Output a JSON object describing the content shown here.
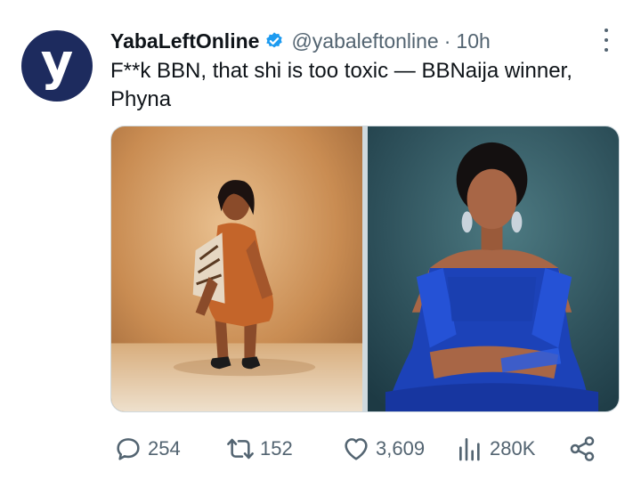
{
  "account": {
    "avatar_letter": "y",
    "name": "YabaLeftOnline",
    "handle": "@yabaleftonline",
    "separator": "·",
    "time": "10h"
  },
  "tweet": {
    "text": "F**k BBN, that shi is too toxic — BBNaija winner, Phyna"
  },
  "media": {
    "images": [
      {
        "name": "photo-orange-dress"
      },
      {
        "name": "photo-blue-gown"
      }
    ]
  },
  "actions": {
    "reply_count": "254",
    "retweet_count": "152",
    "like_count": "3,609",
    "views_count": "280K"
  },
  "colors": {
    "text": "#0f1419",
    "secondary": "#536471",
    "verified": "#1d9bf0",
    "avatar": "#1d2b5e"
  },
  "icons": [
    "verified-badge-icon",
    "more-icon",
    "reply-icon",
    "retweet-icon",
    "like-icon",
    "views-icon",
    "share-icon"
  ]
}
